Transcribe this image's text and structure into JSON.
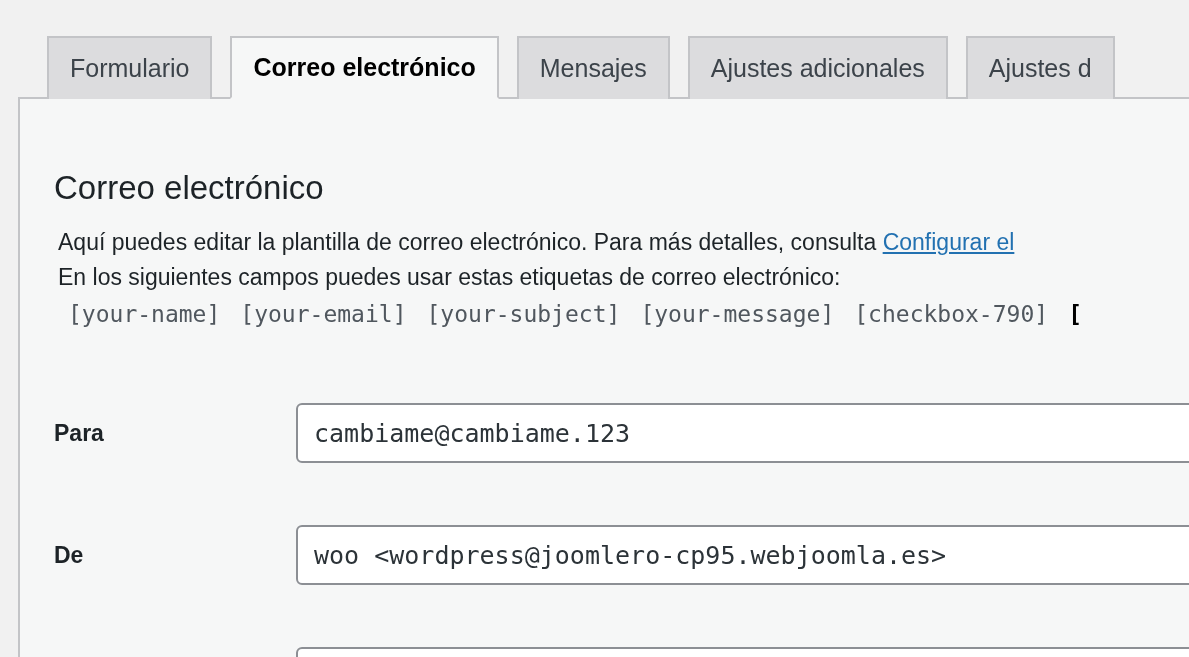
{
  "tabs": [
    {
      "label": "Formulario",
      "selected": false
    },
    {
      "label": "Correo electrónico",
      "selected": true
    },
    {
      "label": "Mensajes",
      "selected": false
    },
    {
      "label": "Ajustes adicionales",
      "selected": false
    },
    {
      "label": "Ajustes d",
      "selected": false
    }
  ],
  "heading": "Correo electrónico",
  "description": {
    "text": "Aquí puedes editar la plantilla de correo electrónico. Para más detalles, consulta",
    "link": "Configurar el"
  },
  "tags_intro": "En los siguientes campos puedes usar estas etiquetas de correo electrónico:",
  "tags": [
    {
      "text": "[your-name]",
      "bold": false
    },
    {
      "text": "[your-email]",
      "bold": false
    },
    {
      "text": "[your-subject]",
      "bold": false
    },
    {
      "text": "[your-message]",
      "bold": false
    },
    {
      "text": "[checkbox-790]",
      "bold": false
    },
    {
      "text": "[",
      "bold": true
    }
  ],
  "fields": [
    {
      "kind": "text",
      "label": "Para",
      "value": "cambiame@cambiame.123"
    },
    {
      "kind": "text",
      "label": "De",
      "value": "woo <wordpress@joomlero-cp95.webjoomla.es>"
    },
    {
      "kind": "text"
    }
  ]
}
